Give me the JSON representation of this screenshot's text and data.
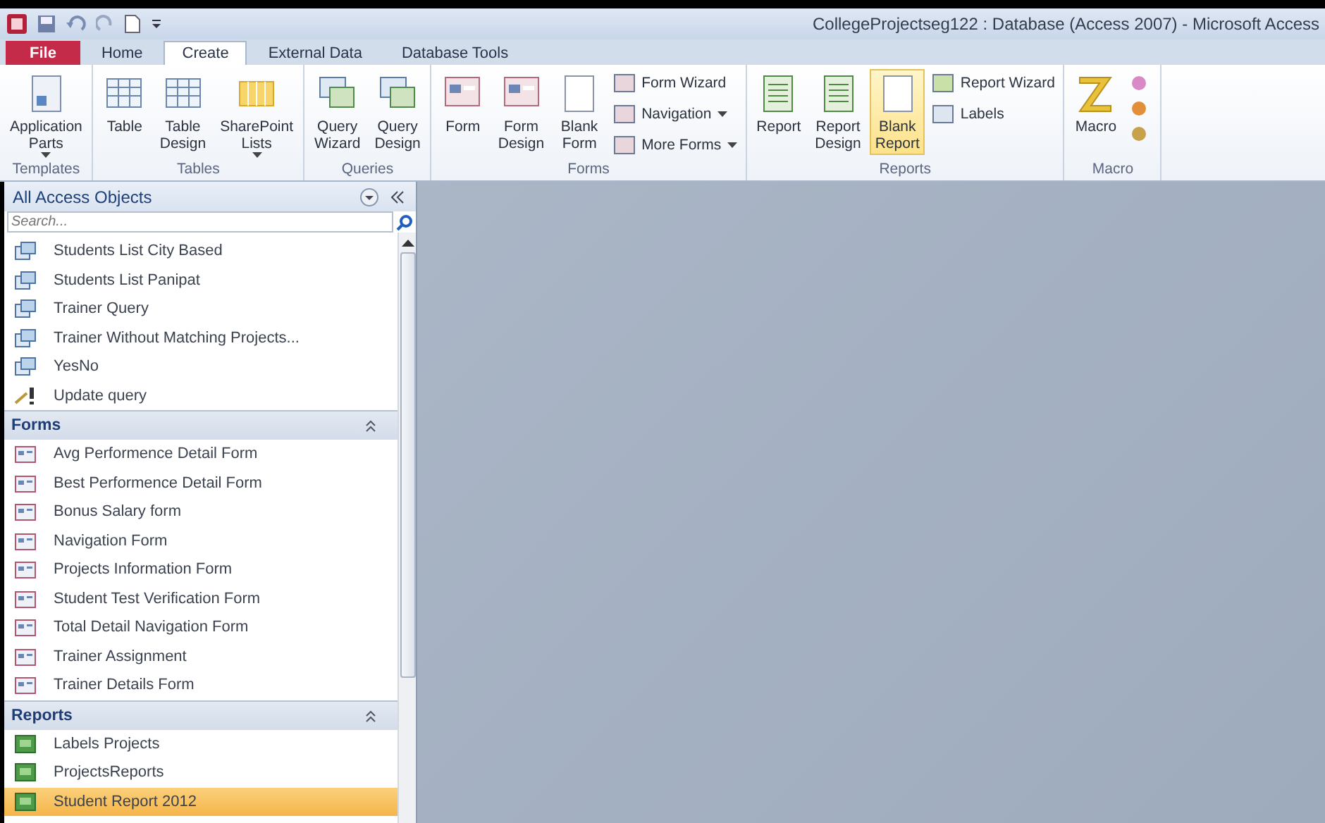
{
  "window": {
    "title": "CollegeProjectseg122 : Database (Access 2007)  -  Microsoft Access"
  },
  "tabs": [
    {
      "label": "File",
      "kind": "file",
      "selected": false
    },
    {
      "label": "Home",
      "kind": "tab",
      "selected": false
    },
    {
      "label": "Create",
      "kind": "tab",
      "selected": true
    },
    {
      "label": "External Data",
      "kind": "tab",
      "selected": false
    },
    {
      "label": "Database Tools",
      "kind": "tab",
      "selected": false
    }
  ],
  "ribbon_groups": [
    {
      "label": "Templates",
      "buttons": [
        {
          "kind": "large",
          "lines": [
            "Application",
            "Parts"
          ],
          "dropdown": true,
          "highlighted": false
        }
      ]
    },
    {
      "label": "Tables",
      "buttons": [
        {
          "kind": "large",
          "lines": [
            "Table"
          ],
          "dropdown": false,
          "highlighted": false
        },
        {
          "kind": "large",
          "lines": [
            "Table",
            "Design"
          ],
          "dropdown": false,
          "highlighted": false
        },
        {
          "kind": "large",
          "lines": [
            "SharePoint",
            "Lists"
          ],
          "dropdown": true,
          "highlighted": false
        }
      ]
    },
    {
      "label": "Queries",
      "buttons": [
        {
          "kind": "large",
          "lines": [
            "Query",
            "Wizard"
          ],
          "dropdown": false,
          "highlighted": false
        },
        {
          "kind": "large",
          "lines": [
            "Query",
            "Design"
          ],
          "dropdown": false,
          "highlighted": false
        }
      ]
    },
    {
      "label": "Forms",
      "buttons": [
        {
          "kind": "large",
          "lines": [
            "Form"
          ],
          "dropdown": false,
          "highlighted": false
        },
        {
          "kind": "large",
          "lines": [
            "Form",
            "Design"
          ],
          "dropdown": false,
          "highlighted": false
        },
        {
          "kind": "large",
          "lines": [
            "Blank",
            "Form"
          ],
          "dropdown": false,
          "highlighted": false
        },
        {
          "kind": "small",
          "lines": [
            "Form Wizard"
          ],
          "dropdown": false,
          "highlighted": false
        },
        {
          "kind": "small",
          "lines": [
            "Navigation"
          ],
          "dropdown": true,
          "highlighted": false
        },
        {
          "kind": "small",
          "lines": [
            "More Forms"
          ],
          "dropdown": true,
          "highlighted": false
        }
      ]
    },
    {
      "label": "Reports",
      "buttons": [
        {
          "kind": "large",
          "lines": [
            "Report"
          ],
          "dropdown": false,
          "highlighted": false
        },
        {
          "kind": "large",
          "lines": [
            "Report",
            "Design"
          ],
          "dropdown": false,
          "highlighted": false
        },
        {
          "kind": "large",
          "lines": [
            "Blank",
            "Report"
          ],
          "dropdown": false,
          "highlighted": true
        },
        {
          "kind": "small",
          "lines": [
            "Report Wizard"
          ],
          "dropdown": false,
          "highlighted": false
        },
        {
          "kind": "small",
          "lines": [
            "Labels"
          ],
          "dropdown": false,
          "highlighted": false
        }
      ]
    },
    {
      "label": "Macro",
      "buttons": [
        {
          "kind": "large",
          "lines": [
            "Macro"
          ],
          "dropdown": false,
          "highlighted": false
        }
      ]
    }
  ],
  "nav_pane": {
    "title": "All Access Objects",
    "search": {
      "placeholder": "Search..."
    },
    "groups": [
      {
        "items": [
          {
            "label": "Students List City Based",
            "kind": "query",
            "selected": false
          },
          {
            "label": "Students List Panipat",
            "kind": "query",
            "selected": false
          },
          {
            "label": "Trainer Query",
            "kind": "query",
            "selected": false
          },
          {
            "label": "Trainer Without Matching Projects...",
            "kind": "query",
            "selected": false
          },
          {
            "label": "YesNo",
            "kind": "query",
            "selected": false
          },
          {
            "label": "Update query",
            "kind": "update",
            "selected": false
          }
        ]
      },
      {
        "title": "Forms",
        "items": [
          {
            "label": "Avg Performence Detail Form",
            "kind": "form",
            "selected": false
          },
          {
            "label": "Best Performence Detail Form",
            "kind": "form",
            "selected": false
          },
          {
            "label": "Bonus Salary form",
            "kind": "form",
            "selected": false
          },
          {
            "label": "Navigation Form",
            "kind": "form",
            "selected": false
          },
          {
            "label": "Projects Information Form",
            "kind": "form",
            "selected": false
          },
          {
            "label": "Student Test Verification Form",
            "kind": "form",
            "selected": false
          },
          {
            "label": "Total Detail Navigation Form",
            "kind": "form",
            "selected": false
          },
          {
            "label": "Trainer Assignment",
            "kind": "form",
            "selected": false
          },
          {
            "label": "Trainer Details Form",
            "kind": "form",
            "selected": false
          }
        ]
      },
      {
        "title": "Reports",
        "items": [
          {
            "label": "Labels Projects",
            "kind": "report",
            "selected": false
          },
          {
            "label": "ProjectsReports",
            "kind": "report",
            "selected": false
          },
          {
            "label": "Student Report 2012",
            "kind": "report",
            "selected": true
          }
        ]
      }
    ]
  }
}
